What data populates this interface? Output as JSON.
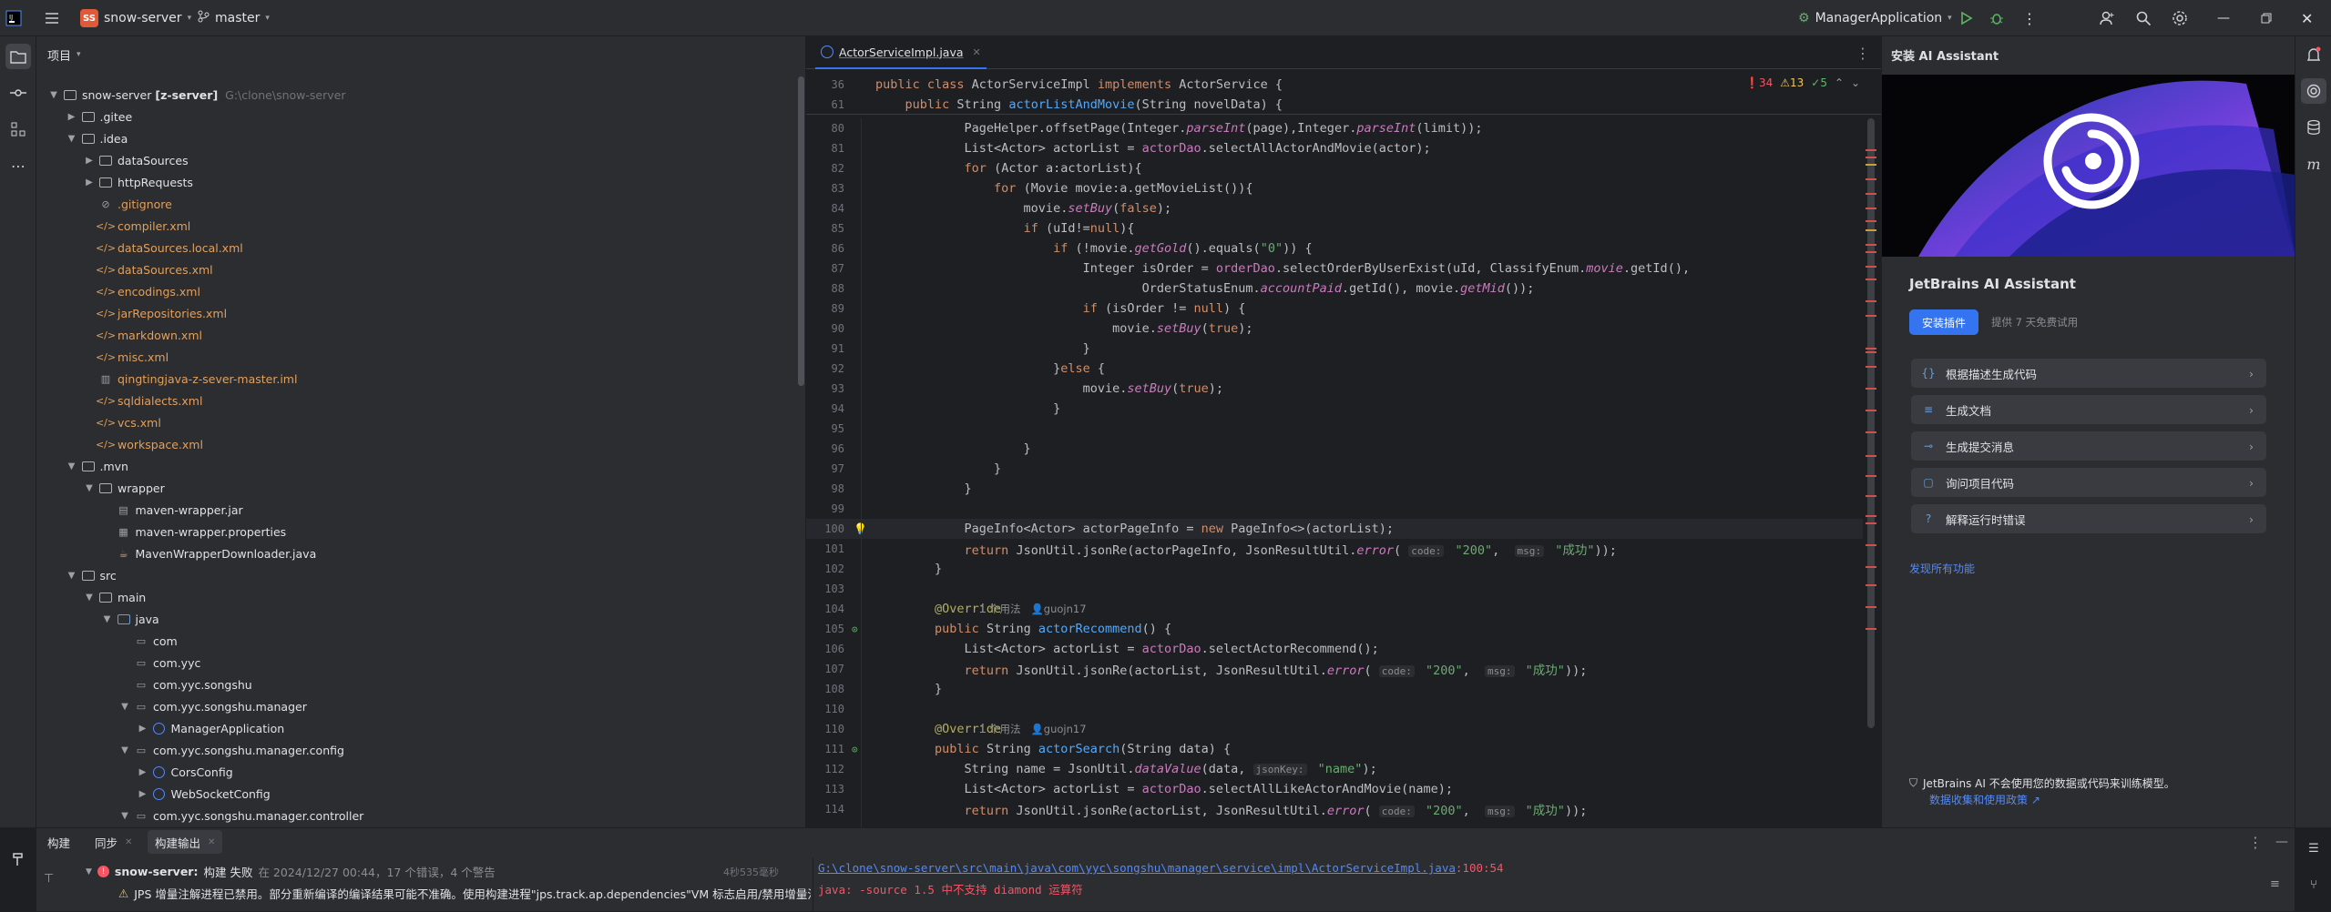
{
  "titlebar": {
    "project_badge": "SS",
    "project_name": "snow-server",
    "branch": "master",
    "run_config": "ManagerApplication"
  },
  "project_panel": {
    "title": "项目",
    "root_name": "snow-server",
    "root_module": "[z-server]",
    "root_path": "G:\\clone\\snow-server",
    "tree": [
      {
        "label": ".gitee",
        "indent": 1,
        "kind": "folder",
        "arrow": "▶"
      },
      {
        "label": ".idea",
        "indent": 1,
        "kind": "folder",
        "arrow": "▼"
      },
      {
        "label": "dataSources",
        "indent": 2,
        "kind": "folder",
        "arrow": "▶"
      },
      {
        "label": "httpRequests",
        "indent": 2,
        "kind": "folder",
        "arrow": "▶"
      },
      {
        "label": ".gitignore",
        "indent": 2,
        "kind": "ignore",
        "arrow": ""
      },
      {
        "label": "compiler.xml",
        "indent": 2,
        "kind": "xml",
        "arrow": ""
      },
      {
        "label": "dataSources.local.xml",
        "indent": 2,
        "kind": "xml",
        "arrow": ""
      },
      {
        "label": "dataSources.xml",
        "indent": 2,
        "kind": "xml",
        "arrow": ""
      },
      {
        "label": "encodings.xml",
        "indent": 2,
        "kind": "xml",
        "arrow": ""
      },
      {
        "label": "jarRepositories.xml",
        "indent": 2,
        "kind": "xml",
        "arrow": ""
      },
      {
        "label": "markdown.xml",
        "indent": 2,
        "kind": "xml",
        "arrow": ""
      },
      {
        "label": "misc.xml",
        "indent": 2,
        "kind": "xml",
        "arrow": ""
      },
      {
        "label": "qingtingjava-z-sever-master.iml",
        "indent": 2,
        "kind": "iml",
        "arrow": ""
      },
      {
        "label": "sqldialects.xml",
        "indent": 2,
        "kind": "xml",
        "arrow": ""
      },
      {
        "label": "vcs.xml",
        "indent": 2,
        "kind": "xml",
        "arrow": ""
      },
      {
        "label": "workspace.xml",
        "indent": 2,
        "kind": "xml",
        "arrow": ""
      },
      {
        "label": ".mvn",
        "indent": 1,
        "kind": "folder",
        "arrow": "▼"
      },
      {
        "label": "wrapper",
        "indent": 2,
        "kind": "folder",
        "arrow": "▼"
      },
      {
        "label": "maven-wrapper.jar",
        "indent": 3,
        "kind": "jar",
        "arrow": ""
      },
      {
        "label": "maven-wrapper.properties",
        "indent": 3,
        "kind": "props",
        "arrow": ""
      },
      {
        "label": "MavenWrapperDownloader.java",
        "indent": 3,
        "kind": "java",
        "arrow": ""
      },
      {
        "label": "src",
        "indent": 1,
        "kind": "folder",
        "arrow": "▼"
      },
      {
        "label": "main",
        "indent": 2,
        "kind": "folder",
        "arrow": "▼"
      },
      {
        "label": "java",
        "indent": 3,
        "kind": "folder-blue",
        "arrow": "▼"
      },
      {
        "label": "com",
        "indent": 4,
        "kind": "package",
        "arrow": ""
      },
      {
        "label": "com.yyc",
        "indent": 4,
        "kind": "package",
        "arrow": ""
      },
      {
        "label": "com.yyc.songshu",
        "indent": 4,
        "kind": "package",
        "arrow": ""
      },
      {
        "label": "com.yyc.songshu.manager",
        "indent": 4,
        "kind": "package",
        "arrow": "▼"
      },
      {
        "label": "ManagerApplication",
        "indent": 5,
        "kind": "class",
        "arrow": "▶"
      },
      {
        "label": "com.yyc.songshu.manager.config",
        "indent": 4,
        "kind": "package",
        "arrow": "▼"
      },
      {
        "label": "CorsConfig",
        "indent": 5,
        "kind": "class",
        "arrow": "▶"
      },
      {
        "label": "WebSocketConfig",
        "indent": 5,
        "kind": "class",
        "arrow": "▶"
      },
      {
        "label": "com.yyc.songshu.manager.controller",
        "indent": 4,
        "kind": "package",
        "arrow": "▼"
      }
    ]
  },
  "editor": {
    "tab_label": "ActorServiceImpl.java",
    "sticky_1": "public class ActorServiceImpl implements ActorService {",
    "sticky_2": "public String actorListAndMovie(String novelData) {",
    "sticky_1_ln": "36",
    "sticky_2_ln": "61",
    "errors": "34",
    "warnings": "13",
    "ok": "5",
    "usage_text": "1 个用法",
    "author": "guojn17",
    "hint_code": "code:",
    "hint_msg": "msg:",
    "hint_jsonkey": "jsonKey:",
    "lines": [
      {
        "n": "80",
        "t": "            PageHelper.offsetPage(Integer.parseInt(page),Integer.parseInt(limit));"
      },
      {
        "n": "81",
        "t": "            List<Actor> actorList = actorDao.selectAllActorAndMovie(actor);"
      },
      {
        "n": "82",
        "t": "            for (Actor a:actorList){"
      },
      {
        "n": "83",
        "t": "                for (Movie movie:a.getMovieList()){"
      },
      {
        "n": "84",
        "t": "                    movie.setBuy(false);"
      },
      {
        "n": "85",
        "t": "                    if (uId!=null){"
      },
      {
        "n": "86",
        "t": "                        if (!movie.getGold().equals(\"0\")) {"
      },
      {
        "n": "87",
        "t": "                            Integer isOrder = orderDao.selectOrderByUserExist(uId, ClassifyEnum.movie.getId(),"
      },
      {
        "n": "88",
        "t": "                                    OrderStatusEnum.accountPaid.getId(), movie.getMid());"
      },
      {
        "n": "89",
        "t": "                            if (isOrder != null) {"
      },
      {
        "n": "90",
        "t": "                                movie.setBuy(true);"
      },
      {
        "n": "91",
        "t": "                            }"
      },
      {
        "n": "92",
        "t": "                        }else {"
      },
      {
        "n": "93",
        "t": "                            movie.setBuy(true);"
      },
      {
        "n": "94",
        "t": "                        }"
      },
      {
        "n": "95",
        "t": ""
      },
      {
        "n": "96",
        "t": "                    }"
      },
      {
        "n": "97",
        "t": "                }"
      },
      {
        "n": "98",
        "t": "            }"
      },
      {
        "n": "99",
        "t": ""
      },
      {
        "n": "100",
        "t": "            PageInfo<Actor> actorPageInfo = new PageInfo<>(actorList);"
      },
      {
        "n": "101",
        "t": "            return JsonUtil.jsonRe(actorPageInfo, JsonResultUtil.error( code: \"200\",  msg: \"成功\"));"
      },
      {
        "n": "102",
        "t": "        }"
      },
      {
        "n": "103",
        "t": ""
      },
      {
        "n": "104",
        "t": "        @Override"
      },
      {
        "n": "105",
        "t": "        public String actorRecommend() {"
      },
      {
        "n": "106",
        "t": "            List<Actor> actorList = actorDao.selectActorRecommend();"
      },
      {
        "n": "107",
        "t": "            return JsonUtil.jsonRe(actorList, JsonResultUtil.error( code: \"200\",  msg: \"成功\"));"
      },
      {
        "n": "108",
        "t": "        }"
      },
      {
        "n": "110",
        "t": ""
      },
      {
        "n": "110",
        "t": "        @Override"
      },
      {
        "n": "111",
        "t": "        public String actorSearch(String data) {"
      },
      {
        "n": "112",
        "t": "            String name = JsonUtil.dataValue(data, jsonKey: \"name\");"
      },
      {
        "n": "113",
        "t": "            List<Actor> actorList = actorDao.selectAllLikeActorAndMovie(name);"
      },
      {
        "n": "114",
        "t": "            return JsonUtil.jsonRe(actorList, JsonResultUtil.error( code: \"200\",  msg: \"成功\"));"
      }
    ]
  },
  "ai_panel": {
    "header": "安装 AI Assistant",
    "title": "JetBrains AI Assistant",
    "install_button": "安装插件",
    "trial_text": "提供 7 天免费试用",
    "items": [
      "根据描述生成代码",
      "生成文档",
      "生成提交消息",
      "询问项目代码",
      "解释运行时错误"
    ],
    "discover": "发现所有功能",
    "privacy_text": "JetBrains AI 不会使用您的数据或代码来训练模型。",
    "privacy_link": "数据收集和使用政策 ↗"
  },
  "bottom_panel": {
    "tabs": [
      "构建",
      "同步",
      "构建输出"
    ],
    "build_status_name": "snow-server:",
    "build_status": "构建 失败",
    "build_time": "在 2024/12/27 00:44，17 个错误，4 个警告",
    "duration": "4秒535毫秒",
    "warning_line": "JPS 增量注解进程已禁用。部分重新编译的编译结果可能不准确。使用构建进程\"jps.track.ap.dependencies\"VM 标志启用/禁用增量注解",
    "output_path": "G:\\clone\\snow-server\\src\\main\\java\\com\\yyc\\songshu\\manager\\service\\impl\\ActorServiceImpl.java",
    "output_pos": ":100:54",
    "output_error": "java: -source 1.5 中不支持 diamond 运算符"
  },
  "colors": {
    "accent": "#3574f0",
    "error": "#f75464",
    "warning": "#f2c55c",
    "keyword": "#cf8e6d",
    "method": "#56a8f5"
  }
}
